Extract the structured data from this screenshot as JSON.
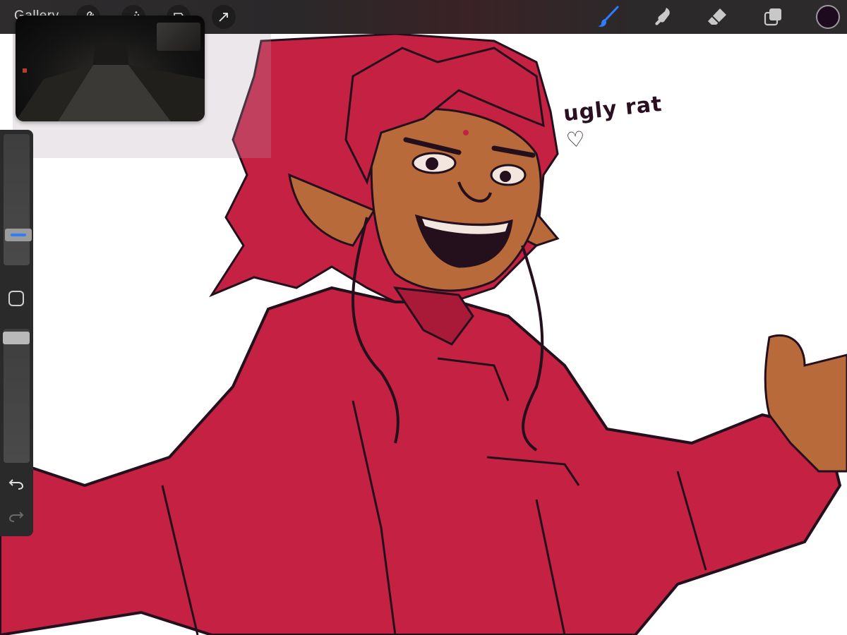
{
  "toolbar": {
    "gallery_label": "Gallery",
    "left_tools": [
      "wrench-icon",
      "magic-wand-icon",
      "selection-icon",
      "transform-arrow-icon"
    ],
    "right_tools": [
      "brush-icon",
      "smudge-icon",
      "eraser-icon",
      "layers-icon"
    ],
    "active_tool": "brush-icon",
    "current_color": "#1e0a1e",
    "accent_color": "#2f7dff"
  },
  "canvas": {
    "handwritten_note": "ugly rat",
    "colors": {
      "jacket": "#c42143",
      "skin": "#b86a3a",
      "lineart": "#24101c"
    }
  },
  "sidebar": {
    "brush_size_level": 0.2,
    "brush_opacity_level": 0.0
  }
}
